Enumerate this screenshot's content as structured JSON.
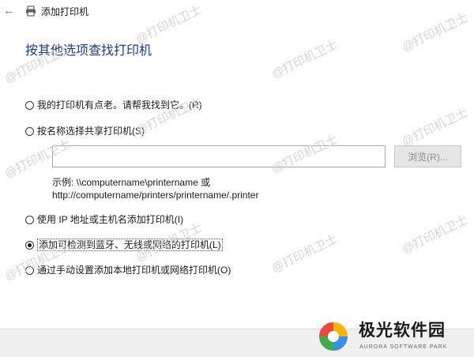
{
  "window": {
    "title": "添加打印机",
    "back_icon": "back-arrow-icon",
    "printer_icon": "printer-icon"
  },
  "heading": "按其他选项查找打印机",
  "options": [
    {
      "label": "我的打印机有点老。请帮我找到它。",
      "hotkey": "(R)",
      "checked": false
    },
    {
      "label": "按名称选择共享打印机",
      "hotkey": "(S)",
      "checked": false
    },
    {
      "label": "使用 IP 地址或主机名添加打印机",
      "hotkey": "(I)",
      "checked": false
    },
    {
      "label": "添加可检测到蓝牙、无线或网络的打印机",
      "hotkey": "(L)",
      "checked": true
    },
    {
      "label": "通过手动设置添加本地打印机或网络打印机",
      "hotkey": "(O)",
      "checked": false
    }
  ],
  "shared_printer": {
    "input_value": "",
    "browse_label": "浏览(R)...",
    "example_line1": "示例: \\\\computername\\printername 或",
    "example_line2": "http://computername/printers/printername/.printer"
  },
  "watermark": "@打印机卫士",
  "logo": {
    "name": "极光软件园",
    "subtitle": "AURORA SOFTWARE PARK"
  },
  "colors": {
    "heading": "#1f3a86",
    "footer_bg": "#f0f0f0",
    "watermark": "#d6d6d6"
  }
}
